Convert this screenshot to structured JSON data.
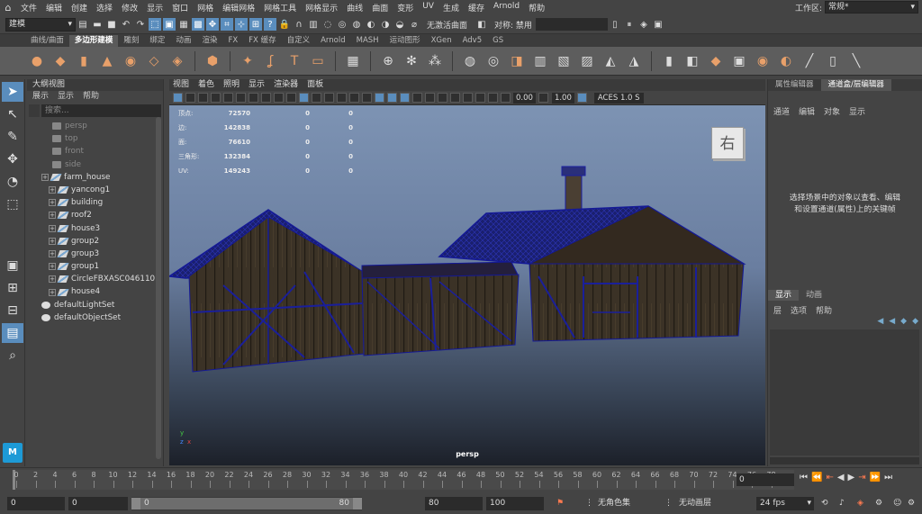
{
  "menubar": {
    "items": [
      "文件",
      "编辑",
      "创建",
      "选择",
      "修改",
      "显示",
      "窗口",
      "网格",
      "编辑网格",
      "网格工具",
      "网格显示",
      "曲线",
      "曲面",
      "变形",
      "UV",
      "生成",
      "缓存",
      "Arnold",
      "帮助"
    ],
    "workspace_label": "工作区:",
    "workspace_value": "常规*"
  },
  "statusline": {
    "mode": "建模",
    "no_active_surface": "无激活曲面",
    "symmetry_label": "对称: 禁用"
  },
  "shelf": {
    "tabs": [
      "曲线/曲面",
      "多边形建模",
      "雕刻",
      "绑定",
      "动画",
      "渲染",
      "FX",
      "FX 缓存",
      "自定义",
      "Arnold",
      "MASH",
      "运动图形",
      "XGen",
      "Adv5",
      "GS"
    ],
    "active_tab": "多边形建模"
  },
  "outliner": {
    "title": "大纲视图",
    "menu": [
      "展示",
      "显示",
      "帮助"
    ],
    "search_placeholder": "搜索...",
    "items": [
      {
        "label": "persp",
        "type": "camera",
        "depth": 1,
        "expandable": false
      },
      {
        "label": "top",
        "type": "camera",
        "depth": 1,
        "expandable": false
      },
      {
        "label": "front",
        "type": "camera",
        "depth": 1,
        "expandable": false
      },
      {
        "label": "side",
        "type": "camera",
        "depth": 1,
        "expandable": false
      },
      {
        "label": "farm_house",
        "type": "mesh",
        "depth": 0,
        "expandable": true
      },
      {
        "label": "yancong1",
        "type": "mesh",
        "depth": 1,
        "expandable": true
      },
      {
        "label": "building",
        "type": "mesh",
        "depth": 1,
        "expandable": true
      },
      {
        "label": "roof2",
        "type": "mesh",
        "depth": 1,
        "expandable": true
      },
      {
        "label": "house3",
        "type": "mesh",
        "depth": 1,
        "expandable": true
      },
      {
        "label": "group2",
        "type": "mesh",
        "depth": 1,
        "expandable": true
      },
      {
        "label": "group3",
        "type": "mesh",
        "depth": 1,
        "expandable": true
      },
      {
        "label": "group1",
        "type": "mesh",
        "depth": 1,
        "expandable": true
      },
      {
        "label": "CircleFBXASC046110",
        "type": "mesh",
        "depth": 1,
        "expandable": true
      },
      {
        "label": "house4",
        "type": "mesh",
        "depth": 1,
        "expandable": true
      },
      {
        "label": "defaultLightSet",
        "type": "set",
        "depth": 0,
        "expandable": false
      },
      {
        "label": "defaultObjectSet",
        "type": "set",
        "depth": 0,
        "expandable": false
      }
    ]
  },
  "viewport": {
    "menu": [
      "视图",
      "着色",
      "照明",
      "显示",
      "渲染器",
      "面板"
    ],
    "exposure": "0.00",
    "gamma": "1.00",
    "color_space": "ACES 1.0 S",
    "camera": "persp",
    "viewcube_label": "右",
    "hud": [
      {
        "key": "顶点:",
        "v1": "72570",
        "v2": "0",
        "v3": "0"
      },
      {
        "key": "边:",
        "v1": "142838",
        "v2": "0",
        "v3": "0"
      },
      {
        "key": "面:",
        "v1": "76610",
        "v2": "0",
        "v3": "0"
      },
      {
        "key": "三角形:",
        "v1": "132384",
        "v2": "0",
        "v3": "0"
      },
      {
        "key": "UV:",
        "v1": "149243",
        "v2": "0",
        "v3": "0"
      }
    ]
  },
  "right_panel": {
    "tabs": [
      "属性编辑器",
      "通道盒/层编辑器"
    ],
    "active_tab": "通道盒/层编辑器",
    "menu": [
      "通道",
      "编辑",
      "对象",
      "显示"
    ],
    "hint_line1": "选择场景中的对象以查看、编辑",
    "hint_line2": "和设置通道(属性)上的关键帧",
    "layer_tabs": [
      "显示",
      "动画"
    ],
    "layer_menu": [
      "层",
      "选项",
      "帮助"
    ]
  },
  "timeline": {
    "ticks": [
      0,
      2,
      4,
      6,
      8,
      10,
      12,
      14,
      16,
      18,
      20,
      22,
      24,
      26,
      28,
      30,
      32,
      34,
      36,
      38,
      40,
      42,
      44,
      46,
      48,
      50,
      52,
      54,
      56,
      58,
      60,
      62,
      64,
      66,
      68,
      70,
      72,
      74,
      76,
      78
    ],
    "current_frame": "0"
  },
  "range": {
    "start": "0",
    "anim_start": "0",
    "range_low": "0",
    "range_high": "80",
    "anim_end": "80",
    "end": "100",
    "character_set": "无角色集",
    "anim_layer": "无动画层",
    "fps": "24 fps"
  }
}
